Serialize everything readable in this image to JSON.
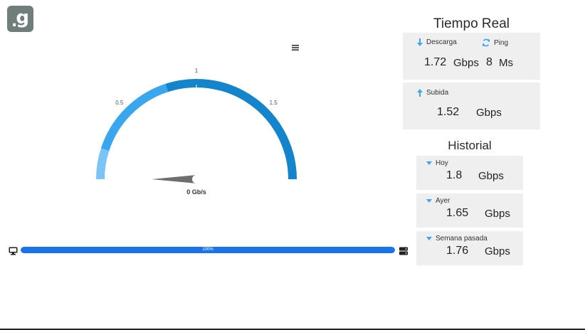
{
  "logo": {
    "dot": ".",
    "letter": "g"
  },
  "gauge": {
    "min": 0,
    "max": 2,
    "value": 0,
    "ticks": [
      "0.5",
      "1",
      "1.5"
    ],
    "readout": "0 Gb/s"
  },
  "progress": {
    "percent_value": 100,
    "label": "100%"
  },
  "realtime": {
    "title": "Tiempo Real",
    "download": {
      "label": "Descarga",
      "value": "1.72",
      "unit": "Gbps"
    },
    "ping": {
      "label": "Ping",
      "value": "8",
      "unit": "Ms"
    },
    "upload": {
      "label": "Subida",
      "value": "1.52",
      "unit": "Gbps"
    }
  },
  "history": {
    "title": "Historial",
    "items": [
      {
        "label": "Hoy",
        "value": "1.8",
        "unit": "Gbps"
      },
      {
        "label": "Ayer",
        "value": "1.65",
        "unit": "Gbps"
      },
      {
        "label": "Semana pasada",
        "value": "1.76",
        "unit": "Gbps"
      }
    ]
  },
  "colors": {
    "accent": "#1a73e8",
    "gauge_light": "#7cc4f8",
    "gauge_mid": "#3aa6ef",
    "gauge_dark": "#1485cc",
    "card_bg": "#efefef"
  }
}
